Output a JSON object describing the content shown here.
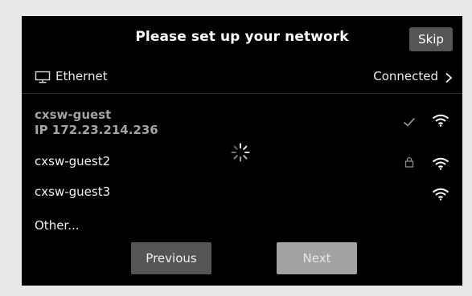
{
  "header": {
    "title": "Please set up your network",
    "skip_label": "Skip"
  },
  "ethernet": {
    "label": "Ethernet",
    "status": "Connected",
    "icon": "monitor-icon"
  },
  "networks": [
    {
      "name": "cxsw-guest",
      "ip": "IP  172.23.214.236",
      "connected": true,
      "secured": false
    },
    {
      "name": "cxsw-guest2",
      "connected": false,
      "secured": true
    },
    {
      "name": "cxsw-guest3",
      "connected": false,
      "secured": false
    }
  ],
  "other_label": "Other...",
  "footer": {
    "previous_label": "Previous",
    "next_label": "Next"
  },
  "colors": {
    "background": "#000000",
    "button": "#555555",
    "button_disabled": "#a3a3a3",
    "muted_text": "#a3a3a3"
  }
}
